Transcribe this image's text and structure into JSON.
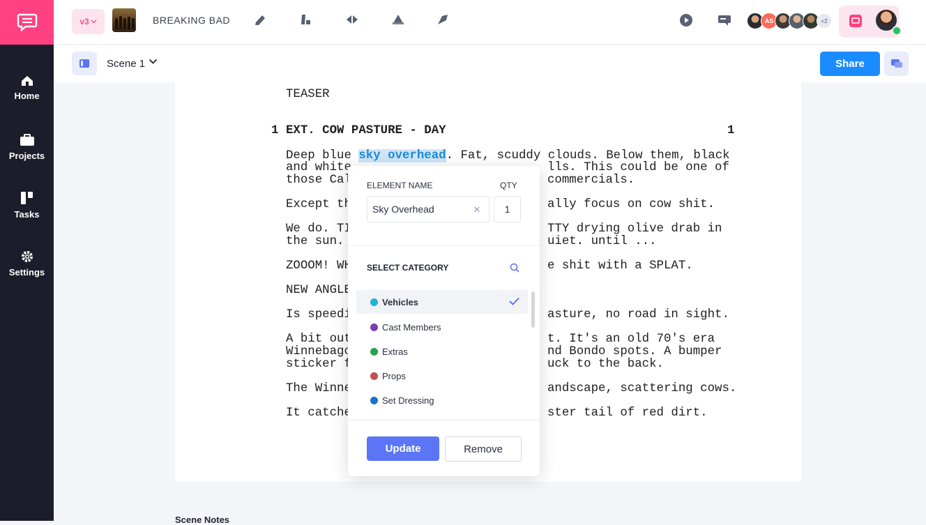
{
  "nav": {
    "items": [
      {
        "label": "Home",
        "icon": "home-icon"
      },
      {
        "label": "Projects",
        "icon": "briefcase-icon"
      },
      {
        "label": "Tasks",
        "icon": "kanban-icon"
      },
      {
        "label": "Settings",
        "icon": "gear-icon"
      }
    ]
  },
  "topbar": {
    "version": "v3",
    "project_title": "BREAKING BAD",
    "avatar_initials": "AS",
    "avatar_more": "+2",
    "tools": [
      "pencil-icon",
      "scene-tool-icon",
      "diamond-tool-icon",
      "triangle-tool-icon",
      "pen-tool-icon"
    ]
  },
  "scenebar": {
    "scene_label": "Scene 1",
    "share_label": "Share"
  },
  "script": {
    "section": "TEASER",
    "scene_number": "1",
    "scene_heading": "EXT. COW PASTURE - DAY",
    "scene_number_right": "1",
    "highlight": "sky overhead",
    "lines": {
      "l1_pre": "Deep blue ",
      "l1_post": ". Fat, scuddy clouds. Below them, black",
      "l2a": "and white",
      "l2b": "lls. This could be one of",
      "l3a": "those Cal",
      "l3b": "commercials.",
      "l4a": "Except th",
      "l4b": "ally focus on cow shit.",
      "l5a": "We do. TI",
      "l5b": "TTY drying olive drab in",
      "l6a": "the sun.",
      "l6b": "uiet. until ...",
      "l7a": "ZOOOM! WH",
      "l7b": "e shit with a SPLAT.",
      "l8a": "NEW ANGLE",
      "l9a": "Is speedi",
      "l9b": "asture, no road in sight.",
      "l10a": "A bit out",
      "l10b": "t. It's an old 70's era",
      "l11a": "Winnebago",
      "l11b": "nd Bondo spots. A bumper",
      "l12a": "sticker f",
      "l12b": "uck to the back.",
      "l13a": "The Winne",
      "l13b": "andscape, scattering cows.",
      "l14a": "It catche",
      "l14b": "ster tail of red dirt."
    }
  },
  "scene_notes": "Scene Notes",
  "popup": {
    "element_name_label": "ELEMENT NAME",
    "qty_label": "QTY",
    "element_name_value": "Sky Overhead",
    "qty_value": "1",
    "select_category_label": "SELECT CATEGORY",
    "categories": [
      {
        "label": "Vehicles",
        "color": "#1fb3d5",
        "selected": true
      },
      {
        "label": "Cast Members",
        "color": "#7b3fb0",
        "selected": false
      },
      {
        "label": "Extras",
        "color": "#27a252",
        "selected": false
      },
      {
        "label": "Props",
        "color": "#c0504d",
        "selected": false
      },
      {
        "label": "Set Dressing",
        "color": "#1a73c8",
        "selected": false
      }
    ],
    "update_label": "Update",
    "remove_label": "Remove"
  },
  "colors": {
    "brand_pink": "#ff4081",
    "sidebar": "#1c1d2b",
    "primary_blue": "#1a8cff",
    "update_blue": "#5b75f6"
  }
}
